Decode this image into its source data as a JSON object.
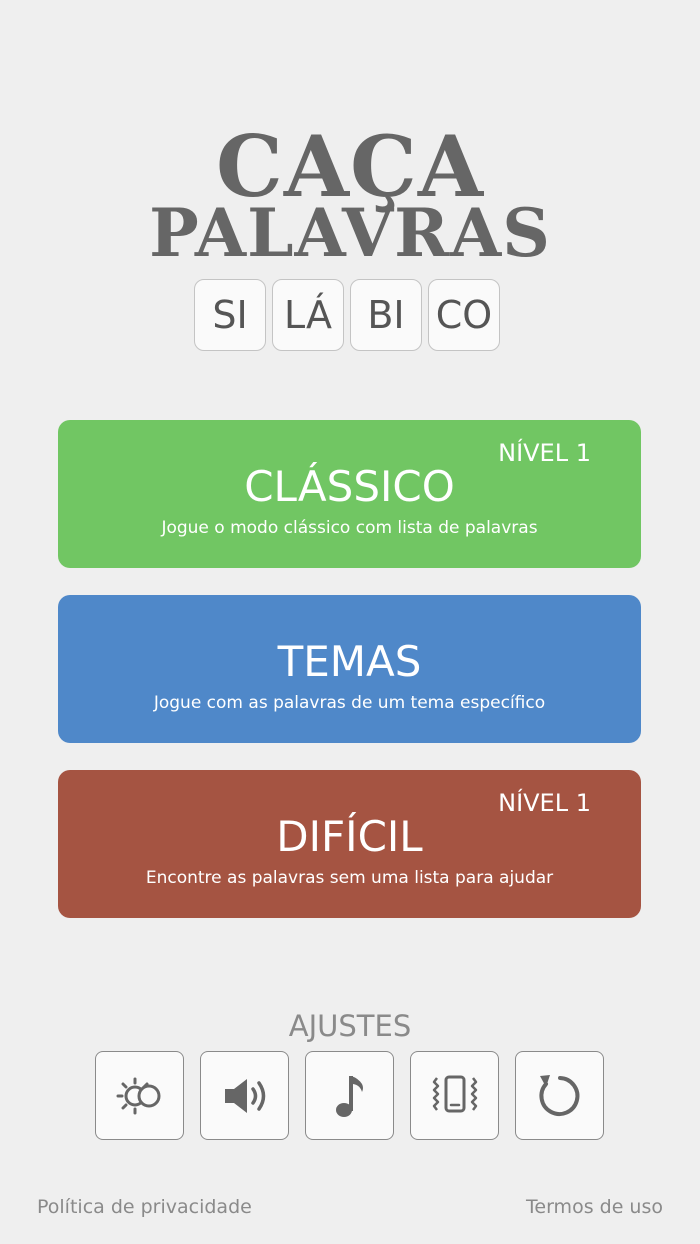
{
  "logo": {
    "line1": "CAÇA",
    "line2": "PALAVRAS",
    "syllables": [
      "SI",
      "LÁ",
      "BI",
      "CO"
    ]
  },
  "modes": [
    {
      "title": "CLÁSSICO",
      "subtitle": "Jogue o modo clássico com lista de palavras",
      "level": "NÍVEL 1",
      "color": "#71c663"
    },
    {
      "title": "TEMAS",
      "subtitle": "Jogue com as palavras de um tema específico",
      "color": "#4f88c9"
    },
    {
      "title": "DIFÍCIL",
      "subtitle": "Encontre as palavras sem uma lista para ajudar",
      "level": "NÍVEL 1",
      "color": "#a55442"
    }
  ],
  "settings": {
    "title": "AJUSTES",
    "buttons": [
      "theme-toggle-icon",
      "sound-icon",
      "music-note-icon",
      "vibration-icon",
      "reset-icon"
    ]
  },
  "footer": {
    "privacy": "Política de privacidade",
    "terms": "Termos de uso"
  }
}
